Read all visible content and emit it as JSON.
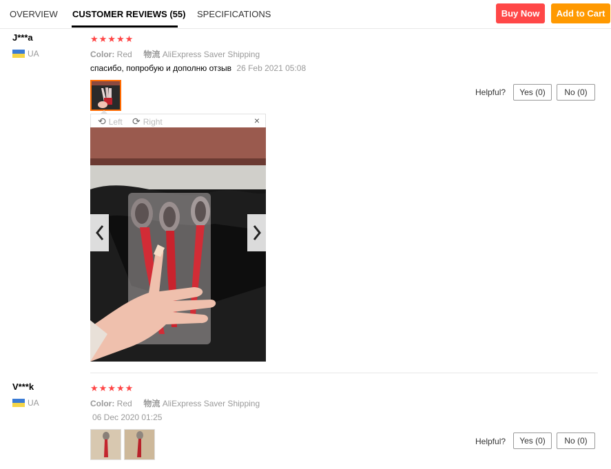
{
  "tabs": [
    {
      "label": "OVERVIEW",
      "active": false
    },
    {
      "label": "CUSTOMER REVIEWS (55)",
      "active": true
    },
    {
      "label": "SPECIFICATIONS",
      "active": false
    }
  ],
  "actions": {
    "buy_now": "Buy Now",
    "add_to_cart": "Add to Cart"
  },
  "colors": {
    "buy_now": "#ff4747",
    "add_to_cart": "#ff9900",
    "stars": "#ff4747",
    "selected_thumb": "#ff6a00"
  },
  "reviews": [
    {
      "user": "J***a",
      "country": "UA",
      "stars": "★★★★★",
      "color_label": "Color:",
      "color_value": "Red",
      "logistics_label": "物流",
      "logistics_value": "AliExpress Saver Shipping",
      "text": "спасибо, попробую и дополню отзыв",
      "date": "26 Feb 2021 05:08",
      "helpful_label": "Helpful?",
      "yes": "Yes (0)",
      "no": "No (0)",
      "photo_count": 1
    },
    {
      "user": "V***k",
      "country": "UA",
      "stars": "★★★★★",
      "color_label": "Color:",
      "color_value": "Red",
      "logistics_label": "物流",
      "logistics_value": "AliExpress Saver Shipping",
      "text": "",
      "date": "06 Dec 2020 01:25",
      "helpful_label": "Helpful?",
      "yes": "Yes (0)",
      "no": "No (0)",
      "photo_count": 2
    }
  ],
  "viewer": {
    "rotate_left": "Left",
    "rotate_right": "Right",
    "close": "×"
  }
}
